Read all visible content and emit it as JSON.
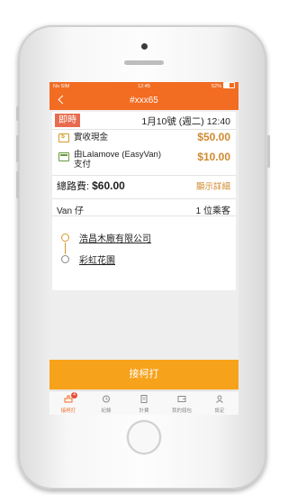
{
  "status_bar": {
    "carrier": "No SIM",
    "time": "12:45",
    "battery": "52%"
  },
  "nav": {
    "title": "#xxx65"
  },
  "order": {
    "urgent_badge": "即時",
    "datetime": "1月10號 (週二) 12:40",
    "payments": [
      {
        "icon": "cash-icon",
        "label": "實收現金",
        "amount": "$50.00"
      },
      {
        "icon": "lalamove-icon",
        "label_line1": "由Lalamove (EasyVan)",
        "label_line2": "支付",
        "amount": "$10.00"
      }
    ],
    "total_label": "總路費:",
    "total_amount": "$60.00",
    "details_link": "顯示詳細",
    "vehicle": "Van 仔",
    "passengers": "1 位乘客",
    "stops": [
      "浩昌木廠有限公司",
      "彩虹花園"
    ]
  },
  "accept_button": "接柯打",
  "tabs": [
    {
      "label": "接柯打",
      "icon": "hand-icon",
      "badge": "4"
    },
    {
      "label": "紀錄",
      "icon": "history-icon"
    },
    {
      "label": "計費",
      "icon": "bill-icon"
    },
    {
      "label": "我的錢包",
      "icon": "wallet-icon"
    },
    {
      "label": "設定",
      "icon": "profile-icon"
    }
  ],
  "colors": {
    "brand": "#f26c22",
    "accent": "#f7a21b",
    "amount": "#cf8a2e",
    "urgent": "#e86b4f"
  }
}
